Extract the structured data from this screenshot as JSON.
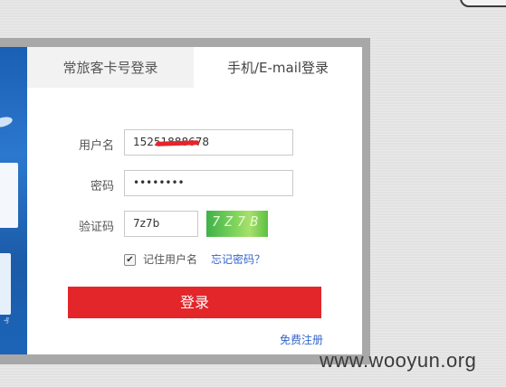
{
  "tabs": {
    "card_login": "常旅客卡号登录",
    "phone_login": "手机/E-mail登录"
  },
  "form": {
    "username_label": "用户名",
    "username_value": "15251888678",
    "password_label": "密码",
    "password_value": "••••••••",
    "captcha_label": "验证码",
    "captcha_value": "7z7b",
    "captcha_image_text": "7Z7B",
    "remember_label": "记住用户名",
    "remember_checked": true,
    "forgot_link": "忘记密码？",
    "login_button": "登录",
    "register_link": "免费注册"
  },
  "watermark": "www.wooyun.org",
  "colors": {
    "login_button": "#e3262a",
    "link": "#3366cc",
    "side_banner": "#1d64b8",
    "redaction": "#e8232a"
  }
}
